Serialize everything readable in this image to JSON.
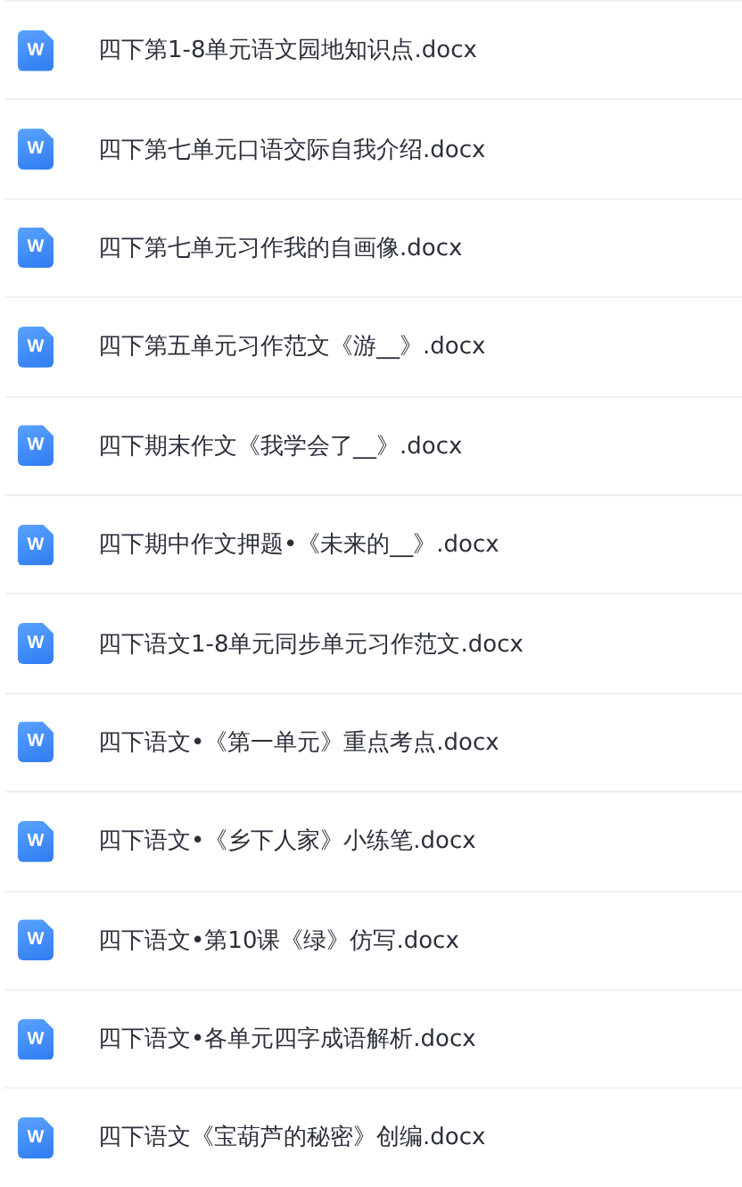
{
  "files": [
    {
      "icon_letter": "W",
      "name": "四下第1-8单元语文园地知识点.docx"
    },
    {
      "icon_letter": "W",
      "name": "四下第七单元口语交际自我介绍.docx"
    },
    {
      "icon_letter": "W",
      "name": "四下第七单元习作我的自画像.docx"
    },
    {
      "icon_letter": "W",
      "name": "四下第五单元习作范文《游__》.docx"
    },
    {
      "icon_letter": "W",
      "name": "四下期末作文《我学会了__》.docx"
    },
    {
      "icon_letter": "W",
      "name": "四下期中作文押题•《未来的__》.docx"
    },
    {
      "icon_letter": "W",
      "name": "四下语文1-8单元同步单元习作范文.docx"
    },
    {
      "icon_letter": "W",
      "name": "四下语文•《第一单元》重点考点.docx"
    },
    {
      "icon_letter": "W",
      "name": "四下语文•《乡下人家》小练笔.docx"
    },
    {
      "icon_letter": "W",
      "name": "四下语文•第10课《绿》仿写.docx"
    },
    {
      "icon_letter": "W",
      "name": "四下语文•各单元四字成语解析.docx"
    },
    {
      "icon_letter": "W",
      "name": "四下语文《宝葫芦的秘密》创编.docx"
    }
  ]
}
